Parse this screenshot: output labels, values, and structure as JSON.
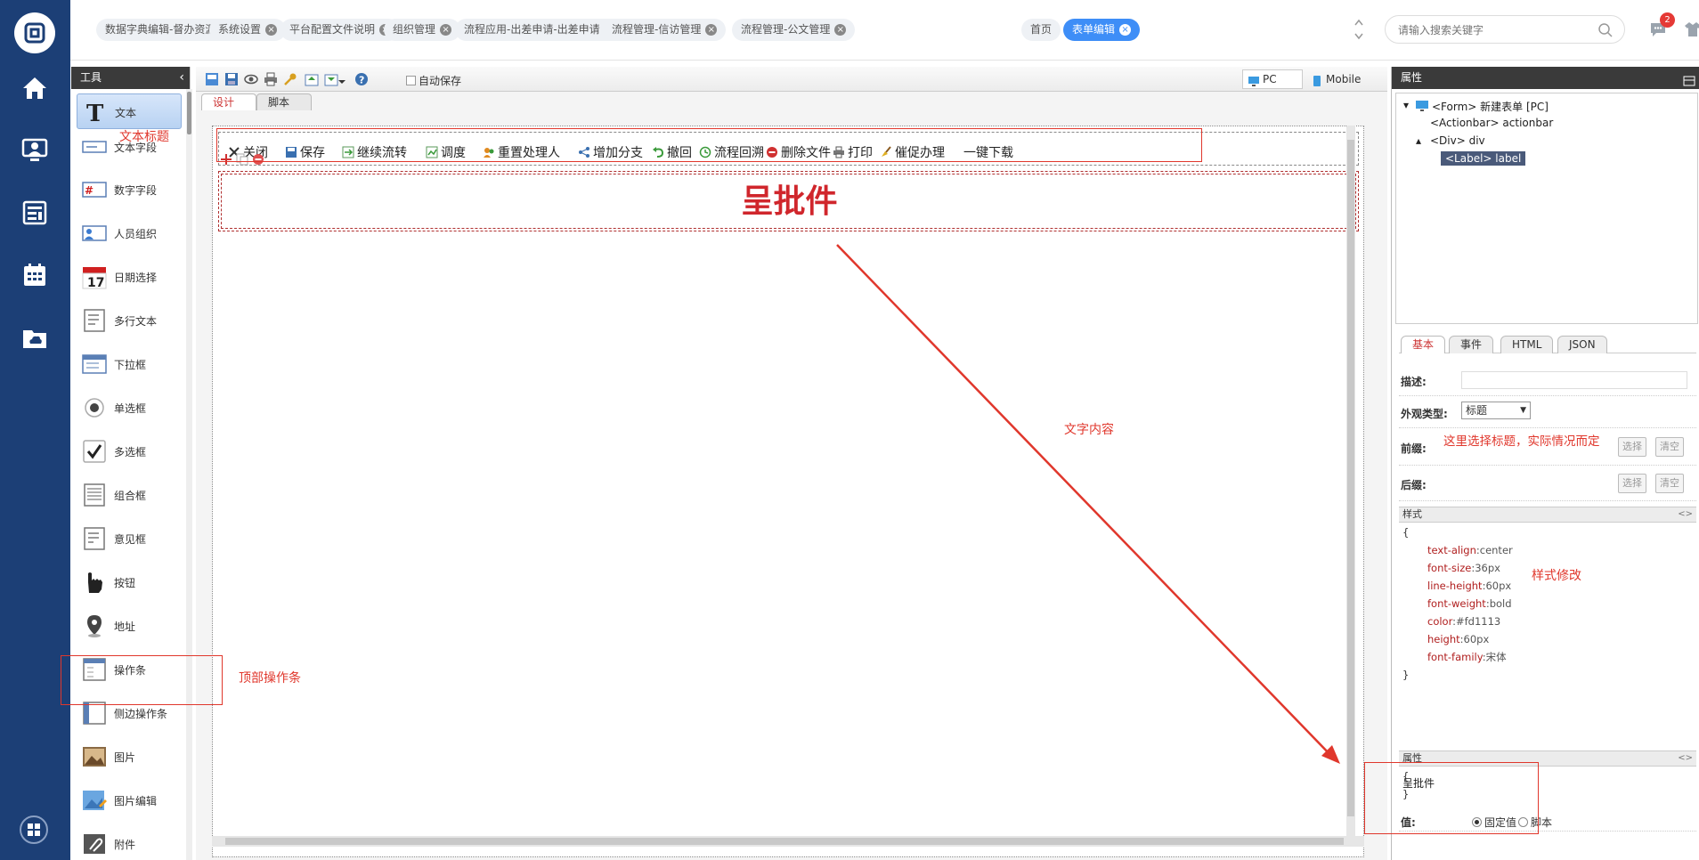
{
  "nav": {
    "icons": [
      "logo-icon",
      "home-icon",
      "user-monitor-icon",
      "news-icon",
      "calendar-icon",
      "cloud-folder-icon",
      "apps-icon"
    ]
  },
  "tabs": [
    {
      "label": "数据字典编辑-督办资源",
      "active": false
    },
    {
      "label": "系统设置",
      "active": false
    },
    {
      "label": "平台配置文件说明",
      "active": false
    },
    {
      "label": "组织管理",
      "active": false
    },
    {
      "label": "流程应用-出差申请-出差申请",
      "active": false
    },
    {
      "label": "流程管理-信访管理",
      "active": false
    },
    {
      "label": "流程管理-公文管理",
      "active": false
    },
    {
      "label": "首页",
      "active": false,
      "closable": false
    },
    {
      "label": "表单编辑",
      "active": true
    }
  ],
  "search": {
    "placeholder": "请输入搜索关键字"
  },
  "notifications": {
    "count": "2"
  },
  "toolpanel": {
    "title": "工具",
    "items": [
      "文本",
      "文本字段",
      "数字字段",
      "人员组织",
      "日期选择",
      "多行文本",
      "下拉框",
      "单选框",
      "多选框",
      "组合框",
      "意见框",
      "按钮",
      "地址",
      "操作条",
      "侧边操作条",
      "图片",
      "图片编辑",
      "附件"
    ]
  },
  "designer": {
    "autosave_label": "自动保存",
    "device_pc": "PC",
    "device_mobile": "Mobile",
    "subtab_design": "设计",
    "subtab_script": "脚本",
    "actions": [
      "关闭",
      "保存",
      "继续流转",
      "调度",
      "重置处理人",
      "增加分支",
      "撤回",
      "流程回溯",
      "删除文件",
      "打印",
      "催促办理",
      "一键下载"
    ],
    "title_text": "呈批件"
  },
  "props": {
    "title": "属性",
    "tree": [
      {
        "text": "<Form> 新建表单 [PC]",
        "level": 0,
        "selected": false
      },
      {
        "text": "<Actionbar> actionbar",
        "level": 1,
        "selected": false
      },
      {
        "text": "<Div> div",
        "level": 1,
        "selected": false
      },
      {
        "text": "<Label> label",
        "level": 2,
        "selected": true
      }
    ],
    "tabs": [
      "基本",
      "事件",
      "HTML",
      "JSON"
    ],
    "desc_label": "描述:",
    "appearance_label": "外观类型:",
    "appearance_value": "标题",
    "prefix_label": "前缀:",
    "suffix_label": "后缀:",
    "select_btn": "选择",
    "clear_btn": "清空",
    "style_head": "样式",
    "style_open": "{",
    "style_close": "}",
    "style_lines": [
      {
        "k": "text-align",
        "v": "center"
      },
      {
        "k": "font-size",
        "v": "36px"
      },
      {
        "k": "line-height",
        "v": "60px"
      },
      {
        "k": "font-weight",
        "v": "bold"
      },
      {
        "k": "color",
        "v": "#fd1113"
      },
      {
        "k": "height",
        "v": "60px"
      },
      {
        "k": "font-family",
        "v": "宋体"
      }
    ],
    "attr_head": "属性",
    "attr_open": "{",
    "attr_close": "}",
    "value_label": "值:",
    "value_fixed": "固定值",
    "value_script": "脚本",
    "value_text": "呈批件"
  },
  "annotations": {
    "text_title": "文本标题",
    "top_actionbar": "顶部操作条",
    "text_content": "文字内容",
    "choose_title": "这里选择标题，实际情况而定",
    "style_edit": "样式修改"
  },
  "colors": {
    "nav_bg": "#1c3f76",
    "accent": "#3e8ef7",
    "title_red": "#d0262c",
    "annotation_red": "#e0372c"
  }
}
